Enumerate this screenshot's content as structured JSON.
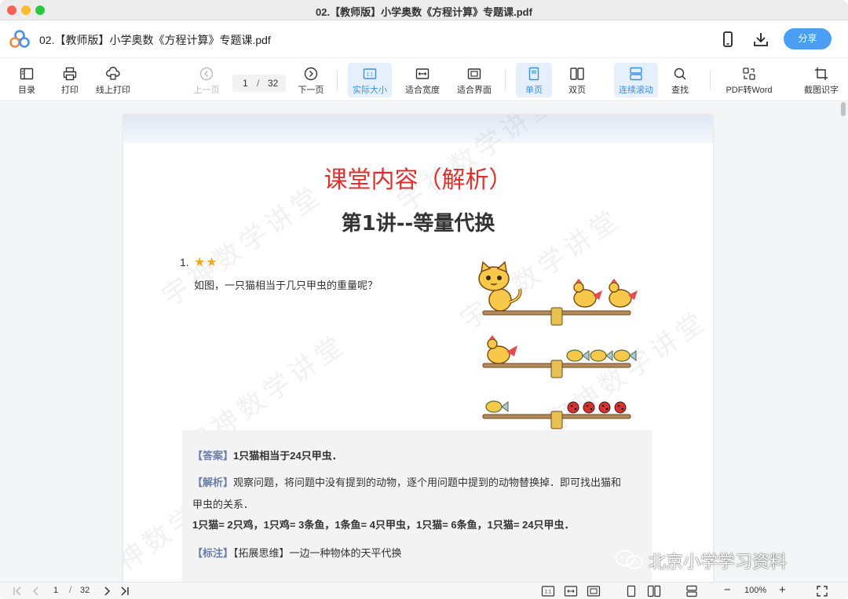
{
  "window": {
    "title": "02.【教师版】小学奥数《方程计算》专题课.pdf"
  },
  "header": {
    "doc_title": "02.【教师版】小学奥数《方程计算》专题课.pdf",
    "share_label": "分享",
    "icons": [
      "app-logo-icon",
      "mobile-icon",
      "download-icon"
    ]
  },
  "toolbar": {
    "toc": "目录",
    "print": "打印",
    "online_print": "线上打印",
    "prev": "上一页",
    "next": "下一页",
    "page_current": "1",
    "page_sep": "/",
    "page_total": "32",
    "actual_size": "实际大小",
    "actual_size_glyph": "1:1",
    "fit_width": "适合宽度",
    "fit_page": "适合界面",
    "single": "单页",
    "double": "双页",
    "continuous": "连续滚动",
    "search": "查找",
    "pdf_to_word": "PDF转Word",
    "ocr": "截图识字"
  },
  "page": {
    "watermark": "宇神数学讲堂",
    "title": "课堂内容（解析）",
    "subtitle": "第1讲--等量代换",
    "question_number": "1.",
    "question_stars": "★★",
    "question_text": "如图，一只猫相当于几只甲虫的重量呢？",
    "answer": {
      "tag1": "【答案】",
      "text1": "1只猫相当于24只甲虫．",
      "tag2": "【解析】",
      "text2a": "观察问题，将问题中没有提到的动物，逐个用问题中提到的动物替换掉．即可找出猫和",
      "text2b": "甲虫的关系．",
      "text3": "1只猫= 2只鸡，1只鸡= 3条鱼，1条鱼= 4只甲虫，1只猫= 6条鱼，1只猫= 24只甲虫．",
      "tag4": "【标注】",
      "text4": "【拓展思维】一边一种物体的天平代换"
    },
    "overlay_watermark": "北京小学学习资料"
  },
  "statusbar": {
    "page_current": "1",
    "page_sep": "/",
    "page_total": "32",
    "zoom": "100%",
    "zoom_minus": "−",
    "zoom_plus": "+",
    "actual_glyph": "1:1"
  },
  "colors": {
    "accent": "#4a9ff5",
    "title_red": "#e0302d",
    "tag_blue": "#6a7ea8",
    "active_bg": "#e6f0fc",
    "star": "#f5a623"
  }
}
